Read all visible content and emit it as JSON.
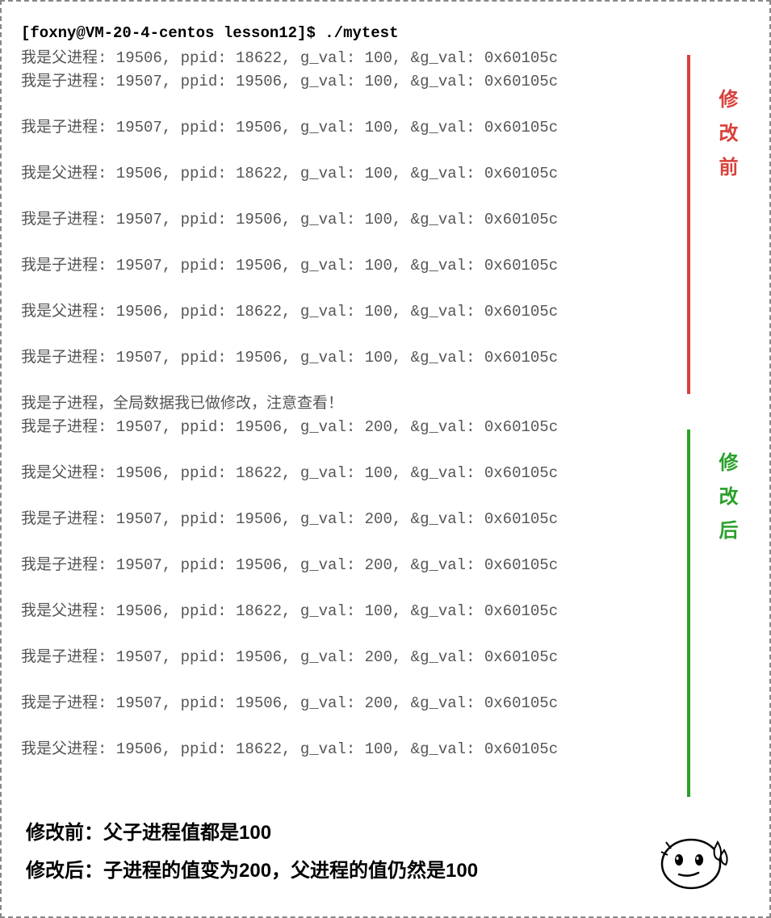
{
  "prompt": "[foxny@VM-20-4-centos lesson12]$ ./mytest",
  "before": {
    "label": "修改前",
    "lines": [
      "我是父进程: 19506, ppid: 18622, g_val: 100, &g_val: 0x60105c",
      "我是子进程: 19507, ppid: 19506, g_val: 100, &g_val: 0x60105c",
      "我是子进程: 19507, ppid: 19506, g_val: 100, &g_val: 0x60105c",
      "我是父进程: 19506, ppid: 18622, g_val: 100, &g_val: 0x60105c",
      "我是子进程: 19507, ppid: 19506, g_val: 100, &g_val: 0x60105c",
      "我是子进程: 19507, ppid: 19506, g_val: 100, &g_val: 0x60105c",
      "我是父进程: 19506, ppid: 18622, g_val: 100, &g_val: 0x60105c",
      "我是子进程: 19507, ppid: 19506, g_val: 100, &g_val: 0x60105c"
    ]
  },
  "notice": "我是子进程，全局数据我已做修改，注意查看！",
  "after": {
    "label": "修改后",
    "lines": [
      "我是子进程: 19507, ppid: 19506, g_val: 200, &g_val: 0x60105c",
      "我是父进程: 19506, ppid: 18622, g_val: 100, &g_val: 0x60105c",
      "我是子进程: 19507, ppid: 19506, g_val: 200, &g_val: 0x60105c",
      "我是子进程: 19507, ppid: 19506, g_val: 200, &g_val: 0x60105c",
      "我是父进程: 19506, ppid: 18622, g_val: 100, &g_val: 0x60105c",
      "我是子进程: 19507, ppid: 19506, g_val: 200, &g_val: 0x60105c",
      "我是子进程: 19507, ppid: 19506, g_val: 200, &g_val: 0x60105c",
      "我是父进程: 19506, ppid: 18622, g_val: 100, &g_val: 0x60105c"
    ]
  },
  "summary": {
    "line1": "修改前：父子进程值都是100",
    "line2": "修改后：子进程的值变为200，父进程的值仍然是100"
  }
}
